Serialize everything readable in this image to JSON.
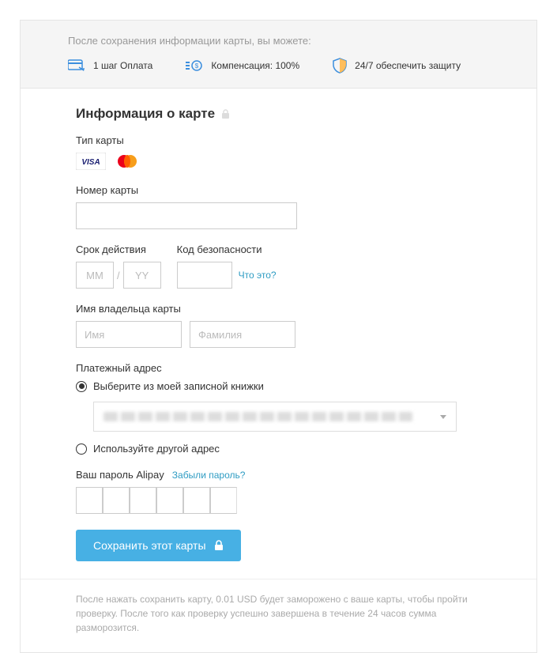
{
  "benefits": {
    "title": "После сохранения информации карты, вы можете:",
    "items": [
      {
        "label": "1 шаг Оплата"
      },
      {
        "label": "Компенсация: 100%"
      },
      {
        "label": "24/7 обеспечить защиту"
      }
    ]
  },
  "section_title": "Информация о карте",
  "card_type_label": "Тип карты",
  "card_number": {
    "label": "Номер карты",
    "value": ""
  },
  "expiry": {
    "label": "Срок действия",
    "mm_placeholder": "MM",
    "yy_placeholder": "YY",
    "mm": "",
    "yy": ""
  },
  "security": {
    "label": "Код безопасности",
    "value": "",
    "help": "Что это?"
  },
  "holder": {
    "label": "Имя владельца карты",
    "first_placeholder": "Имя",
    "last_placeholder": "Фамилия",
    "first": "",
    "last": ""
  },
  "billing": {
    "label": "Платежный адрес",
    "option_book": "Выберите из моей записной книжки",
    "option_other": "Используйте другой адрес"
  },
  "alipay": {
    "label": "Ваш пароль Alipay",
    "forgot": "Забыли пароль?"
  },
  "save_button": "Сохранить этот карты",
  "footer_note": "После нажать сохранить карту, 0.01 USD будет заморожено с ваше карты, чтобы пройти проверку. После того как проверку успешно завершена в течение 24 часов сумма разморозится."
}
